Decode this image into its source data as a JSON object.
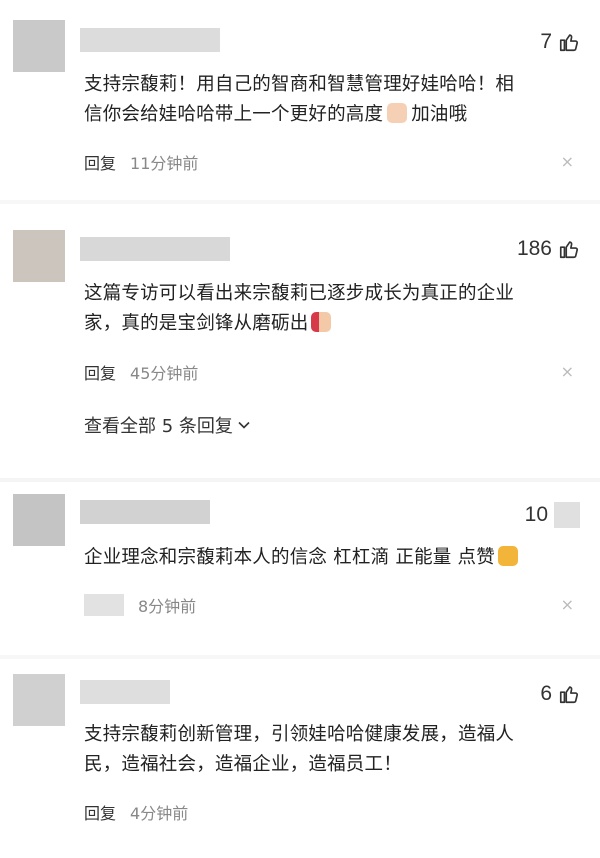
{
  "comments": [
    {
      "likes": "7",
      "text_lines": [
        "支持宗馥莉！用自己的智商和智慧管理好娃哈哈！相",
        "信你会给娃哈哈带上一个更好的高度",
        "加油哦"
      ],
      "reply_label": "回复",
      "time": "11分钟前",
      "close": "×"
    },
    {
      "likes": "186",
      "text_lines": [
        "这篇专访可以看出来宗馥莉已逐步成长为真正的企业",
        "家，真的是宝剑锋从磨砺出"
      ],
      "reply_label": "回复",
      "time": "45分钟前",
      "close": "×",
      "view_all": "查看全部 5 条回复"
    },
    {
      "likes": "10",
      "text_lines": [
        "企业理念和宗馥莉本人的信念 杠杠滴 正能量 点赞"
      ],
      "time": "8分钟前",
      "close": "×"
    },
    {
      "likes": "6",
      "text_lines": [
        "支持宗馥莉创新管理，引领娃哈哈健康发展，造福人",
        "民，造福社会，造福企业，造福员工！"
      ],
      "reply_label": "回复",
      "time": "4分钟前",
      "close": "×"
    }
  ],
  "icons": {
    "like": "thumbs-up-outline",
    "chevron": "chevron-down"
  }
}
